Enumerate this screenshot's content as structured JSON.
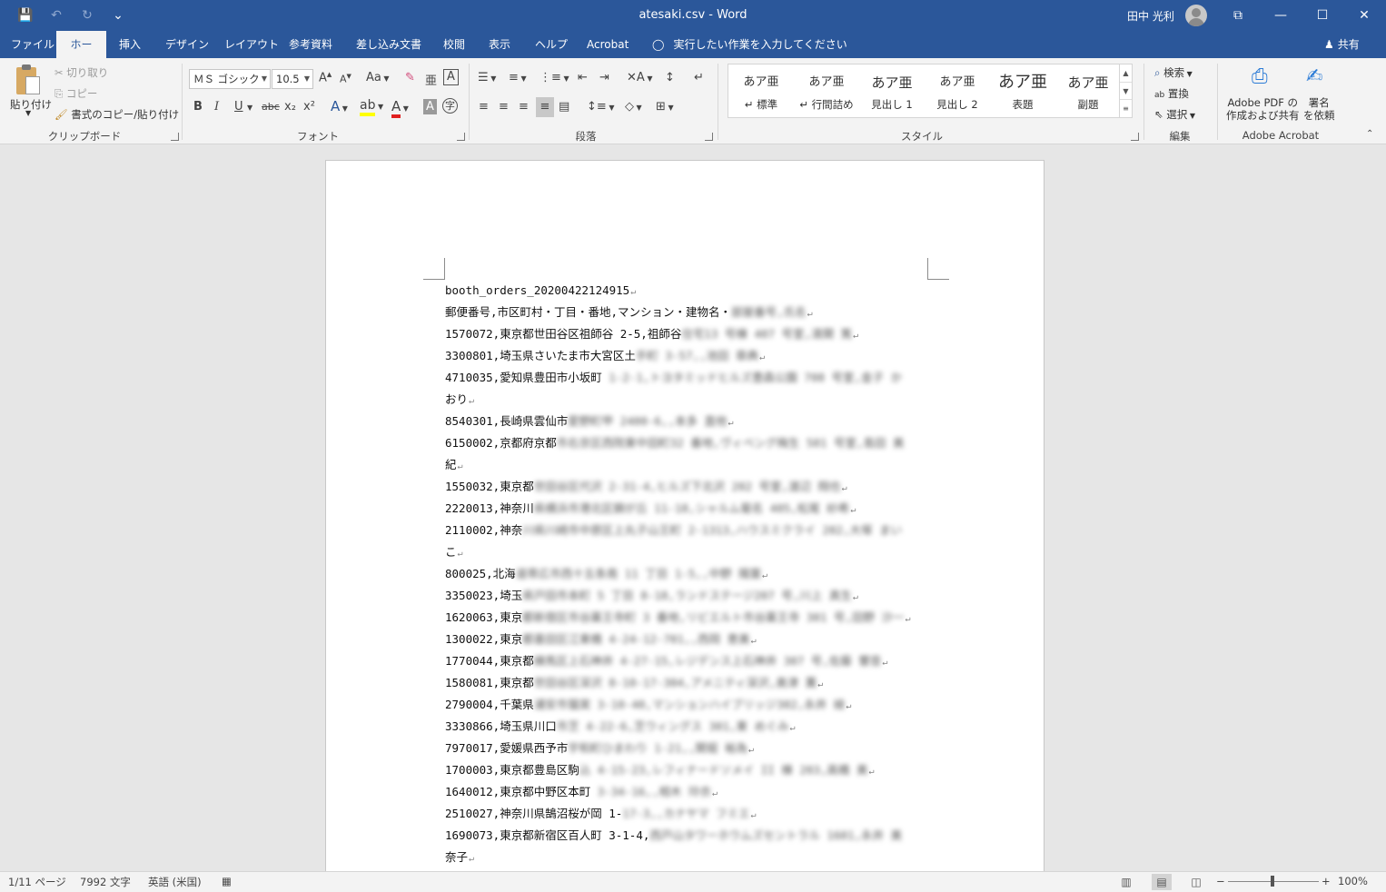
{
  "window": {
    "title": "atesaki.csv  -  Word",
    "user_name": "田中 光利",
    "qat": {
      "save_icon": "💾",
      "undo_icon": "↶",
      "redo_icon": "↻",
      "customize_icon": "⌄"
    },
    "controls": {
      "ribbon_display": "⧉",
      "minimize": "—",
      "maximize": "☐",
      "close": "✕"
    }
  },
  "tabs": [
    "ファイル",
    "ホーム",
    "挿入",
    "デザイン",
    "レイアウト",
    "参考資料",
    "差し込み文書",
    "校閲",
    "表示",
    "ヘルプ",
    "Acrobat"
  ],
  "active_tab": "ホーム",
  "tell_me": "実行したい作業を入力してください",
  "share": "共有",
  "ribbon": {
    "clipboard": {
      "label": "クリップボード",
      "paste": "貼り付け",
      "cut": "切り取り",
      "copy": "コピー",
      "format_painter": "書式のコピー/貼り付け"
    },
    "font": {
      "label": "フォント",
      "font_name": "ＭＳ ゴシック",
      "font_size": "10.5",
      "bold": "B",
      "italic": "I",
      "underline": "U",
      "strike": "abc",
      "subscript": "x₂",
      "superscript": "x²",
      "change_case": "Aa"
    },
    "paragraph": {
      "label": "段落"
    },
    "styles": {
      "label": "スタイル",
      "items": [
        {
          "sample": "あア亜",
          "name": "↵ 標準"
        },
        {
          "sample": "あア亜",
          "name": "↵ 行間詰め"
        },
        {
          "sample": "あア亜",
          "name": "見出し 1"
        },
        {
          "sample": "あア亜",
          "name": "見出し 2"
        },
        {
          "sample": "あア亜",
          "name": "表題"
        },
        {
          "sample": "あア亜",
          "name": "副題"
        }
      ]
    },
    "editing": {
      "label": "編集",
      "find": "検索",
      "replace": "置換",
      "select": "選択"
    },
    "acrobat": {
      "label": "Adobe Acrobat",
      "create_pdf_line1": "Adobe PDF の",
      "create_pdf_line2": "作成および共有",
      "sign_line1": "署名",
      "sign_line2": "を依頼"
    }
  },
  "document": {
    "lines": [
      {
        "text": "booth_orders_20200422124915",
        "hidden": ""
      },
      {
        "text": "郵便番号,市区町村・丁目・番地,マンション・建物名・",
        "hidden": "部屋番号,氏名"
      },
      {
        "text": "1570072,東京都世田谷区祖師谷 2-5,祖師谷",
        "hidden": "住宅13 号棟 407 号室,清関 篤"
      },
      {
        "text": "3300801,埼玉県さいたま市大宮区土",
        "hidden": "手町 3-57,,池田 章典"
      },
      {
        "text": "4710035,愛知県豊田市小坂町 ",
        "hidden": "1-2-1,トヨタミッドヒルズ豊森公園 708 号室,金子 か"
      },
      {
        "text": "おり",
        "hidden": ""
      },
      {
        "text": "8540301,長崎県雲仙市",
        "hidden": "愛野町甲 2400-6,,本多 直他"
      },
      {
        "text": "6150002,京都府京都",
        "hidden": "市右京区西院東中田町32 番地,ヴィベング梅生 501 号室,島田 美"
      },
      {
        "text": "紀",
        "hidden": ""
      },
      {
        "text": "1550032,東京都",
        "hidden": "世田谷区代沢 2-31-4,ヒルズ下北沢 202 号室,渡辺 翔也"
      },
      {
        "text": "2220013,神奈川",
        "hidden": "県横浜市港北区錦が丘 11-18,シャルム菊名 405,松尾 紗希"
      },
      {
        "text": "2110002,神奈",
        "hidden": "川県川崎市中原区上丸子山王町 2-1313,ハウスミクライ 202,大塚 まい"
      },
      {
        "text": "こ",
        "hidden": ""
      },
      {
        "text": "800025,北海",
        "hidden": "道帯広市西十五条南 11 丁目 1-5,,中野 陽葉"
      },
      {
        "text": "3350023,埼玉",
        "hidden": "県戸田市本町 5 丁目 8-18,ランドステージ207 号,川上 真生"
      },
      {
        "text": "1620063,東京",
        "hidden": "都新宿区市谷薬王寺町 3 番地,リビエルト市谷薬王寺 301 号,田野 沙一"
      },
      {
        "text": "1300022,東京",
        "hidden": "都墨田区江東橋 4-24-12-701,,西岡 恵美"
      },
      {
        "text": "1770044,東京都",
        "hidden": "練馬区上石神井 4-27-15,レジデンス上石神井 307 号,佐藤 響音"
      },
      {
        "text": "1580081,東京都",
        "hidden": "世田谷区深沢 8-10-17-304,アメニティ深沢,奥津 薫"
      },
      {
        "text": "2790004,千葉県",
        "hidden": "浦安市猫実 3-10-40,マンションハイブリッジ302,永井 綾"
      },
      {
        "text": "3330866,埼玉県川口",
        "hidden": "市芝 4-22-6,芝ウィングス 301,東 めぐみ"
      },
      {
        "text": "7970017,愛媛県西予市",
        "hidden": "宇和町ひまわり 1-21,,関堀 裕為"
      },
      {
        "text": "1700003,東京都豊島区駒",
        "hidden": "込 4-15-23,レフィナードソメイ II 棟 203,高橋 美"
      },
      {
        "text": "1640012,東京都中野区本町 ",
        "hidden": "3-34-16,,相木 玲衣"
      },
      {
        "text": "2510027,神奈川県鵠沼桜が岡 1-",
        "hidden": "17-3,,カナヤマ フミエ"
      },
      {
        "text": "1690073,東京都新宿区百人町 3-1-4,",
        "hidden": "西戸山タワーホウムズセントラル 1601,永井 美"
      },
      {
        "text": "奈子",
        "hidden": ""
      }
    ]
  },
  "status": {
    "page": "1/11 ページ",
    "words": "7992 文字",
    "language": "英語 (米国)",
    "zoom": "100%"
  }
}
